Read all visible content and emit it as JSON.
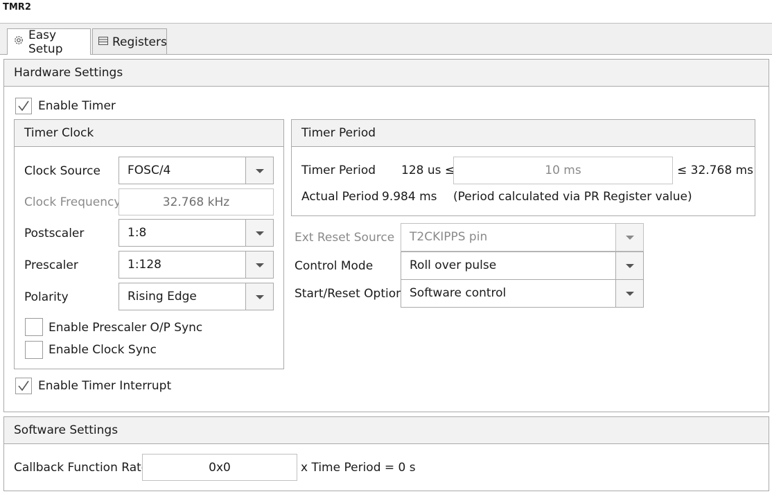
{
  "window": {
    "title": "TMR2"
  },
  "tabs": [
    {
      "label": "Easy Setup",
      "icon": "gear-icon",
      "active": true
    },
    {
      "label": "Registers",
      "icon": "list-icon",
      "active": false
    }
  ],
  "hardware": {
    "title": "Hardware Settings",
    "enable_timer": {
      "label": "Enable Timer",
      "checked": true
    },
    "timer_clock": {
      "title": "Timer Clock",
      "clock_source": {
        "label": "Clock Source",
        "value": "FOSC/4"
      },
      "clock_frequency": {
        "label": "Clock Frequency",
        "value": "32.768 kHz"
      },
      "postscaler": {
        "label": "Postscaler",
        "value": "1:8"
      },
      "prescaler": {
        "label": "Prescaler",
        "value": "1:128"
      },
      "polarity": {
        "label": "Polarity",
        "value": "Rising Edge"
      },
      "prescaler_sync": {
        "label": "Enable Prescaler O/P Sync",
        "checked": false
      },
      "clock_sync": {
        "label": "Enable Clock Sync",
        "checked": false
      }
    },
    "timer_period": {
      "title": "Timer Period",
      "label": "Timer Period",
      "min": "128 us ≤",
      "value": "10 ms",
      "max": "≤ 32.768 ms",
      "actual_label": "Actual Period",
      "actual_value": "9.984 ms",
      "note": "(Period calculated via PR Register value)"
    },
    "ext_reset_source": {
      "label": "Ext Reset Source",
      "value": "T2CKIPPS pin"
    },
    "control_mode": {
      "label": "Control Mode",
      "value": "Roll over pulse"
    },
    "start_reset_option": {
      "label": "Start/Reset Option",
      "value": "Software control"
    },
    "enable_interrupt": {
      "label": "Enable Timer Interrupt",
      "checked": true
    }
  },
  "software": {
    "title": "Software Settings",
    "callback_label": "Callback Function Rate",
    "callback_value": "0x0",
    "callback_suffix": "x Time Period = 0 s"
  },
  "colors": {
    "border": "#a9a9a9",
    "header_bg": "#f2f2f2",
    "disabled_text": "#8a8a8a"
  }
}
